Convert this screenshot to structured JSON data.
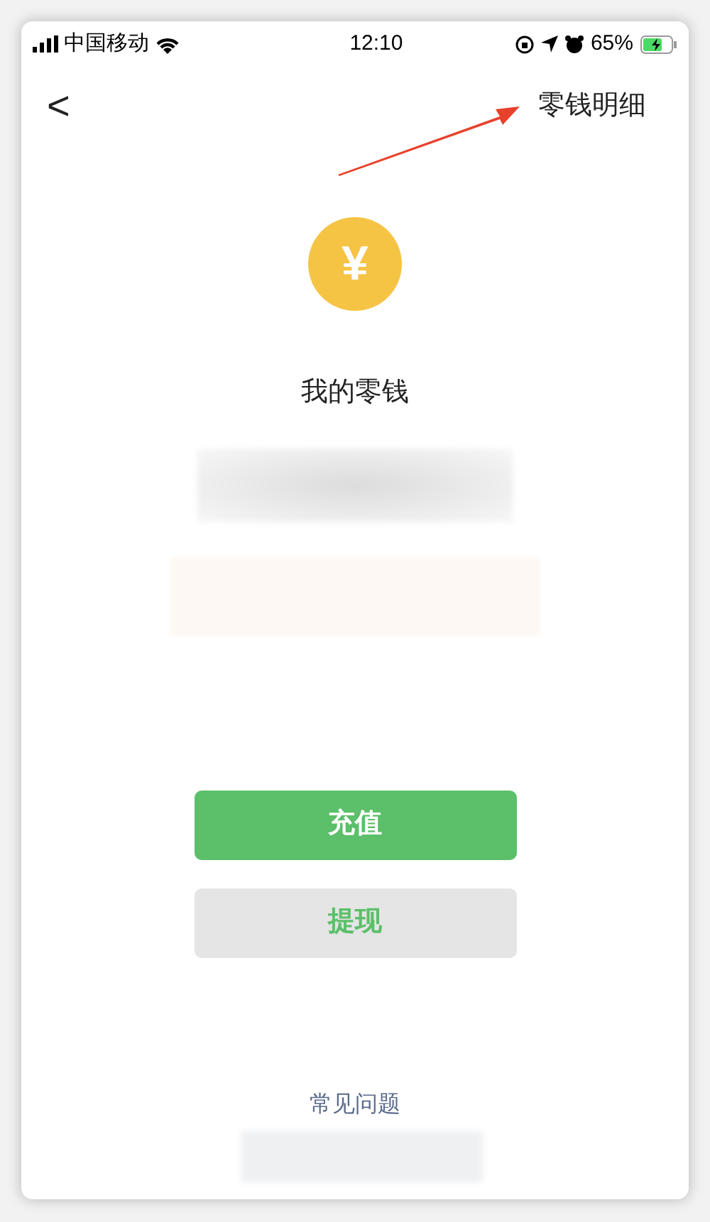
{
  "status_bar": {
    "carrier": "中国移动",
    "time": "12:10",
    "battery": "65%"
  },
  "nav": {
    "back": "<",
    "action": "零钱明细"
  },
  "wallet": {
    "coin": "¥",
    "title": "我的零钱"
  },
  "buttons": [
    {
      "label": "充值",
      "kind": "primary"
    },
    {
      "label": "提现",
      "kind": "secondary"
    }
  ],
  "footer_link": "常见问题"
}
